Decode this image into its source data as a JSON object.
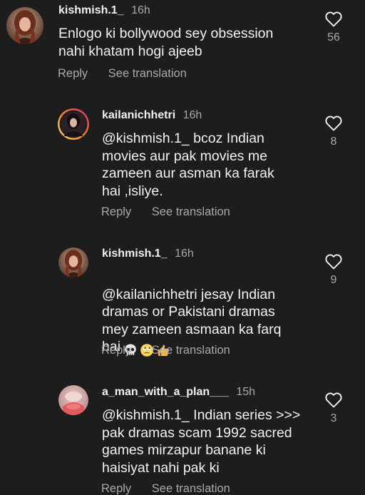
{
  "comments": [
    {
      "username": "kishmish.1_",
      "time": "16h",
      "text": "Enlogo ki bollywood sey obsession\nnahi khatam hogi ajeeb",
      "likes": "56",
      "reply_label": "Reply",
      "translate_label": "See translation",
      "avatar_icon": "profile-photo-woman-dark-hair"
    },
    {
      "username": "kailanichhetri",
      "time": "16h",
      "text": "@kishmish.1_ bcoz Indian\nmovies aur pak movies me\nzameen aur asman ka farak\nhai ,isliye.",
      "likes": "8",
      "reply_label": "Reply",
      "translate_label": "See translation",
      "avatar_icon": "profile-photo-story-ring"
    },
    {
      "username": "kishmish.1_",
      "time": "16h",
      "text": "@kailanichhetri jesay Indian\ndramas or Pakistani dramas\nmey zameen asmaan ka farq\nhai",
      "emojis": [
        "skull-emoji",
        "face-with-rolling-eyes-emoji",
        "thumbs-up-emoji"
      ],
      "likes": "9",
      "reply_label": "Reply",
      "translate_label": "See translation",
      "avatar_icon": "profile-photo-woman-dark-hair"
    },
    {
      "username": "a_man_with_a_plan___",
      "time": "15h",
      "text": "@kishmish.1_ Indian series >>>\npak dramas scam 1992 sacred\ngames mirzapur banane ki\nhaisiyat nahi pak ki",
      "likes": "3",
      "reply_label": "Reply",
      "translate_label": "See translation",
      "avatar_icon": "profile-photo-pink-figure"
    }
  ],
  "icons": {
    "like": "heart-outline-icon"
  },
  "colors": {
    "background": "#1d1d1d",
    "primary_text": "#f2f2f2",
    "secondary_text": "#a8a8a8",
    "story_ring_start": "#feda75",
    "story_ring_end": "#d62976"
  }
}
